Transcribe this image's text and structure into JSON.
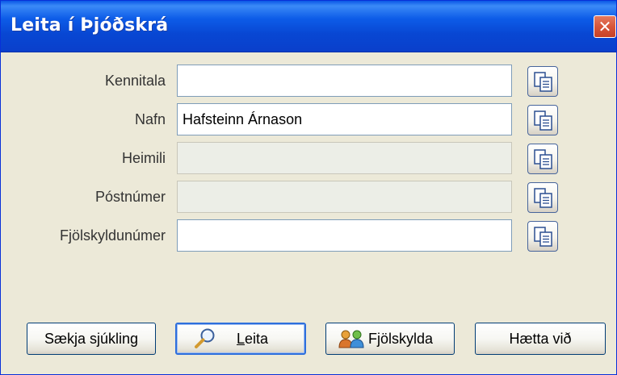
{
  "window": {
    "title": "Leita í Þjóðskrá",
    "close_glyph": "✕"
  },
  "fields": {
    "kennitala": {
      "label": "Kennitala",
      "value": ""
    },
    "nafn": {
      "label": "Nafn",
      "value": "Hafsteinn Árnason"
    },
    "heimili": {
      "label": "Heimili",
      "value": "",
      "disabled": true
    },
    "postnumer": {
      "label": "Póstnúmer",
      "value": "",
      "disabled": true
    },
    "fjolskyldunumer": {
      "label": "Fjölskyldunúmer",
      "value": ""
    }
  },
  "buttons": {
    "saekja_sjukling": {
      "label": "Sækja sjúkling"
    },
    "leita": {
      "label": "Leita",
      "icon": "magnifier-icon"
    },
    "fjolskylda": {
      "label": "Fjölskylda",
      "icon": "family-icon"
    },
    "haetta_vid": {
      "label": "Hætta við"
    }
  },
  "icons": {
    "copy_button_icon": "copy-documents-icon"
  },
  "colors": {
    "titlebar": "#0a57e6",
    "window_background": "#ece9d8",
    "close_button": "#d8563a",
    "default_button_border": "#2e6fdc"
  }
}
